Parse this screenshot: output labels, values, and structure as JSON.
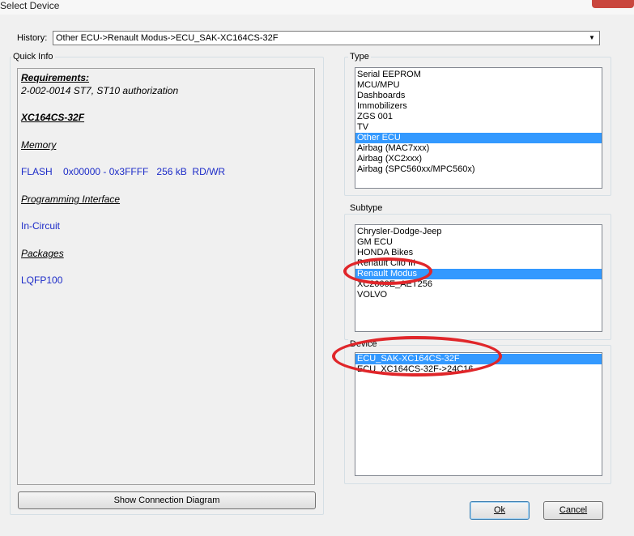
{
  "window": {
    "title": "Select Device"
  },
  "history": {
    "label": "History:",
    "value": "Other ECU->Renault Modus->ECU_SAK-XC164CS-32F"
  },
  "quick_info": {
    "title": "Quick Info",
    "requirements_heading": "Requirements:",
    "requirements_text": "2-002-0014  ST7, ST10 authorization",
    "device_name": "XC164CS-32F",
    "memory_heading": "Memory",
    "memory_text": "FLASH    0x00000 - 0x3FFFF   256 kB  RD/WR",
    "interface_heading": "Programming Interface",
    "interface_text": "In-Circuit",
    "packages_heading": "Packages",
    "packages_text": "LQFP100",
    "diagram_button": "Show Connection Diagram"
  },
  "type": {
    "title": "Type",
    "items": [
      "Serial EEPROM",
      "MCU/MPU",
      "Dashboards",
      "Immobilizers",
      "ZGS 001",
      "TV",
      "Other ECU",
      "Airbag (MAC7xxx)",
      "Airbag (XC2xxx)",
      "Airbag (SPC560xx/MPC560x)"
    ],
    "selected": "Other ECU"
  },
  "subtype": {
    "title": "Subtype",
    "items": [
      "Chrysler-Dodge-Jeep",
      "GM ECU",
      "HONDA Bikes",
      "Renault Clio III",
      "Renault Modus",
      "XC2000E_AET256",
      "VOLVO"
    ],
    "selected": "Renault Modus"
  },
  "device": {
    "title": "Device",
    "items": [
      "ECU_SAK-XC164CS-32F",
      "ECU_XC164CS-32F->24C16"
    ],
    "selected": "ECU_SAK-XC164CS-32F"
  },
  "buttons": {
    "ok": "Ok",
    "cancel": "Cancel"
  },
  "colors": {
    "selection": "#3399ff",
    "highlight_ring": "#e0262a",
    "info_text": "#1c2bc8"
  }
}
